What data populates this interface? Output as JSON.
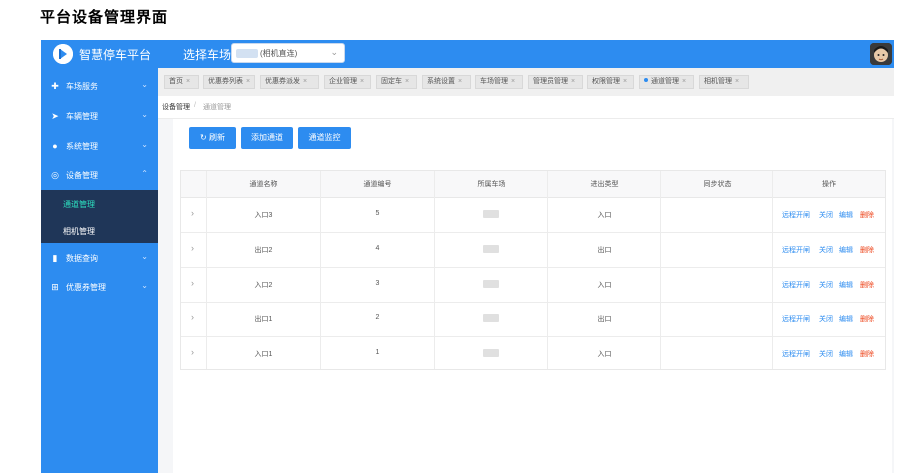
{
  "doc_title": "平台设备管理界面",
  "header": {
    "app_title": "智慧停车平台",
    "lot_label": "选择车场",
    "lot_value": "(相机直连)",
    "lot_caret": "⌄"
  },
  "sidebar": {
    "items": [
      {
        "label": "车场服务",
        "icon": "✚"
      },
      {
        "label": "车辆管理",
        "icon": "➤"
      },
      {
        "label": "系统管理",
        "icon": "●"
      },
      {
        "label": "设备管理",
        "icon": "◎"
      },
      {
        "label": "数据查询",
        "icon": "▮"
      },
      {
        "label": "优惠券管理",
        "icon": "⊞"
      }
    ],
    "sub_items": [
      {
        "label": "通道管理"
      },
      {
        "label": "相机管理"
      }
    ],
    "arrow_down": "⌄",
    "arrow_up": "⌃"
  },
  "tabs": [
    {
      "label": "首页"
    },
    {
      "label": "优惠券列表"
    },
    {
      "label": "优惠券派发"
    },
    {
      "label": "企业管理"
    },
    {
      "label": "固定车"
    },
    {
      "label": "系统设置"
    },
    {
      "label": "车场管理"
    },
    {
      "label": "管理员管理"
    },
    {
      "label": "权限管理"
    },
    {
      "label": "通道管理"
    },
    {
      "label": "相机管理"
    }
  ],
  "tab_close": "×",
  "breadcrumb": {
    "level1": "设备管理",
    "sep": "/",
    "level2": "通道管理"
  },
  "toolbar": {
    "refresh_icon": "↻",
    "refresh": "刷新",
    "add": "添加通道",
    "monitor": "通道监控"
  },
  "table": {
    "headers": [
      "通道名称",
      "通道编号",
      "所属车场",
      "进出类型",
      "同步状态",
      "操作"
    ],
    "rows": [
      {
        "name": "入口3",
        "number": "5",
        "type": "入口"
      },
      {
        "name": "出口2",
        "number": "4",
        "type": "出口"
      },
      {
        "name": "入口2",
        "number": "3",
        "type": "入口"
      },
      {
        "name": "出口1",
        "number": "2",
        "type": "出口"
      },
      {
        "name": "入口1",
        "number": "1",
        "type": "入口"
      }
    ],
    "expand_icon": "›",
    "actions": {
      "remote_open": "远程开闸",
      "close": "关闭",
      "edit": "编辑",
      "delete": "删除"
    }
  },
  "colors": {
    "primary": "#2d8cf0",
    "submenu_bg": "#1f3658",
    "active_sub": "#2de0c0",
    "delete": "#ed3f14"
  }
}
